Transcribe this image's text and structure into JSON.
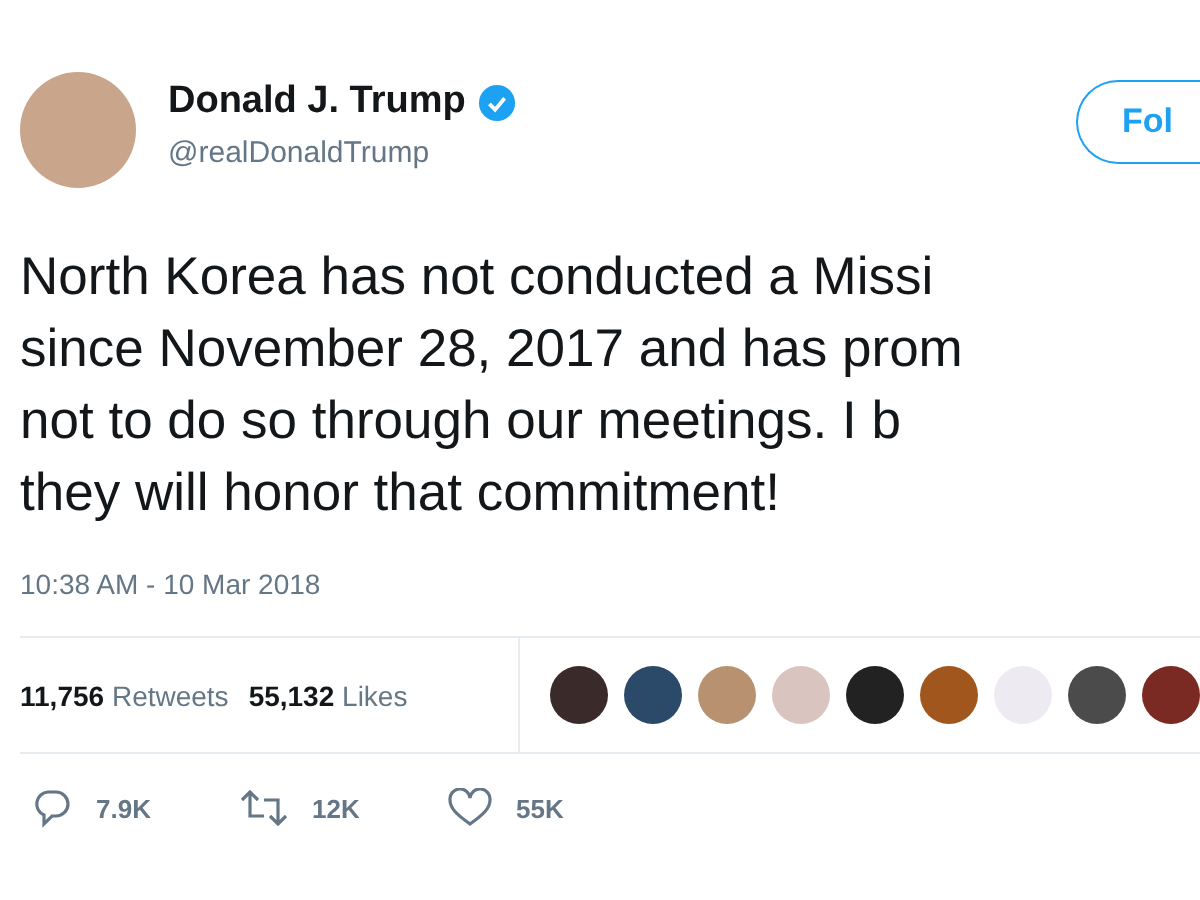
{
  "author": {
    "name": "Donald J. Trump",
    "verified": true,
    "handle": "@realDonaldTrump"
  },
  "follow_button": {
    "label": "Fol"
  },
  "tweet_lines": [
    "North Korea has not conducted a Missi",
    "since November 28, 2017 and has prom",
    "not to do so through our meetings. I b",
    "they will honor that commitment!"
  ],
  "timestamp": "10:38 AM - 10 Mar 2018",
  "stats": [
    {
      "count": "11,756",
      "label": "Retweets"
    },
    {
      "count": "55,132",
      "label": "Likes"
    }
  ],
  "actions": [
    {
      "kind": "reply",
      "count": "7.9K"
    },
    {
      "kind": "retweet",
      "count": "12K"
    },
    {
      "kind": "like",
      "count": "55K"
    }
  ]
}
